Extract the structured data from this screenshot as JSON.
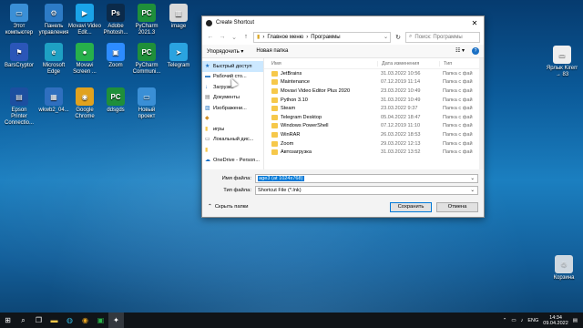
{
  "desktop": {
    "icons": [
      {
        "label": "Этот компьютер",
        "glyph": "▭",
        "color": "#3a8fd6"
      },
      {
        "label": "Панель управления",
        "glyph": "⚙",
        "color": "#2d7bc6"
      },
      {
        "label": "Movavi Video Edit...",
        "glyph": "▶",
        "color": "#1aa3e8"
      },
      {
        "label": "Adobe Photosh...",
        "glyph": "Ps",
        "color": "#0b2a4a"
      },
      {
        "label": "PyCharm 2021.3",
        "glyph": "PC",
        "color": "#1f8f3a"
      },
      {
        "label": "image",
        "glyph": "▦",
        "color": "#d9d9d9"
      },
      {
        "label": "BarsCryptor",
        "glyph": "⚑",
        "color": "#2b56b8"
      },
      {
        "label": "Microsoft Edge",
        "glyph": "e",
        "color": "#1ea0c3"
      },
      {
        "label": "Movavi Screen ...",
        "glyph": "●",
        "color": "#27b04b"
      },
      {
        "label": "Zoom",
        "glyph": "▣",
        "color": "#2d8cff"
      },
      {
        "label": "PyCharm Communi...",
        "glyph": "PC",
        "color": "#1f8f3a"
      },
      {
        "label": "Telegram",
        "glyph": "➤",
        "color": "#2aa3e0"
      },
      {
        "label": "Epson Printer Connectio...",
        "glyph": "▤",
        "color": "#1c4fa0"
      },
      {
        "label": "wkwb2_04...",
        "glyph": "▦",
        "color": "#2f6fbf"
      },
      {
        "label": "Google Chrome",
        "glyph": "◉",
        "color": "#e0a21f"
      },
      {
        "label": "ddsgds",
        "glyph": "PC",
        "color": "#1f8f3a"
      },
      {
        "label": "Новый проект",
        "glyph": "▭",
        "color": "#3a8fd6"
      },
      {
        "label": "Ярлык Kirerr → 83",
        "glyph": "▭",
        "color": "#eeeeee"
      },
      {
        "label": "Корзина",
        "glyph": "♲",
        "color": "#cfd8e0"
      }
    ]
  },
  "dialog": {
    "title": "Create Shortcut",
    "address_parts": [
      "Главное меню",
      "Программы"
    ],
    "search_placeholder": "Поиск: Программы",
    "toolbar": {
      "organize": "Упорядочить ▾",
      "new_folder": "Новая папка"
    },
    "nav": [
      {
        "label": "Быстрый доступ",
        "icon": "star",
        "selected": true
      },
      {
        "label": "Рабочий сто...",
        "icon": "desktop",
        "selected": false
      },
      {
        "label": "Загрузки",
        "icon": "download",
        "selected": false
      },
      {
        "label": "Документы",
        "icon": "docs",
        "selected": false
      },
      {
        "label": "Изображени...",
        "icon": "pictures",
        "selected": false
      },
      {
        "label": "",
        "icon": "app",
        "selected": false
      },
      {
        "label": "игры",
        "icon": "folder",
        "selected": false
      },
      {
        "label": "Локальный дис...",
        "icon": "drive",
        "selected": false
      },
      {
        "label": "",
        "icon": "folder",
        "selected": false
      },
      {
        "label": "OneDrive - Person...",
        "icon": "cloud",
        "selected": false
      }
    ],
    "columns": {
      "name": "Имя",
      "date": "Дата изменения",
      "type": "Тип"
    },
    "files": [
      {
        "name": "JetBrains",
        "date": "31.03.2022 10:56",
        "type": "Папка с фай"
      },
      {
        "name": "Maintenance",
        "date": "07.12.2019 11:14",
        "type": "Папка с фай"
      },
      {
        "name": "Movavi Video Editor Plus 2020",
        "date": "23.03.2022 10:49",
        "type": "Папка с фай"
      },
      {
        "name": "Python 3.10",
        "date": "31.03.2022 10:49",
        "type": "Папка с фай"
      },
      {
        "name": "Steam",
        "date": "23.03.2022 9:37",
        "type": "Папка с фай"
      },
      {
        "name": "Telegram Desktop",
        "date": "05.04.2022 18:47",
        "type": "Папка с фай"
      },
      {
        "name": "Windows PowerShell",
        "date": "07.12.2019 11:10",
        "type": "Папка с фай"
      },
      {
        "name": "WinRAR",
        "date": "26.03.2022 18:53",
        "type": "Папка с фай"
      },
      {
        "name": "Zoom",
        "date": "29.03.2022 12:13",
        "type": "Папка с фай"
      },
      {
        "name": "Автозагрузка",
        "date": "31.03.2022 13:52",
        "type": "Папка с фай"
      }
    ],
    "filename_label": "Имя файла:",
    "filename_value": "age3 (at 1024x768)",
    "filetype_label": "Тип файла:",
    "filetype_value": "Shortcut File (*.lnk)",
    "hide_folders": "Скрыть папки",
    "save": "Сохранить",
    "cancel": "Отмена"
  },
  "taskbar": {
    "lang": "ENG",
    "time": "14:34",
    "date": "09.04.2022"
  }
}
